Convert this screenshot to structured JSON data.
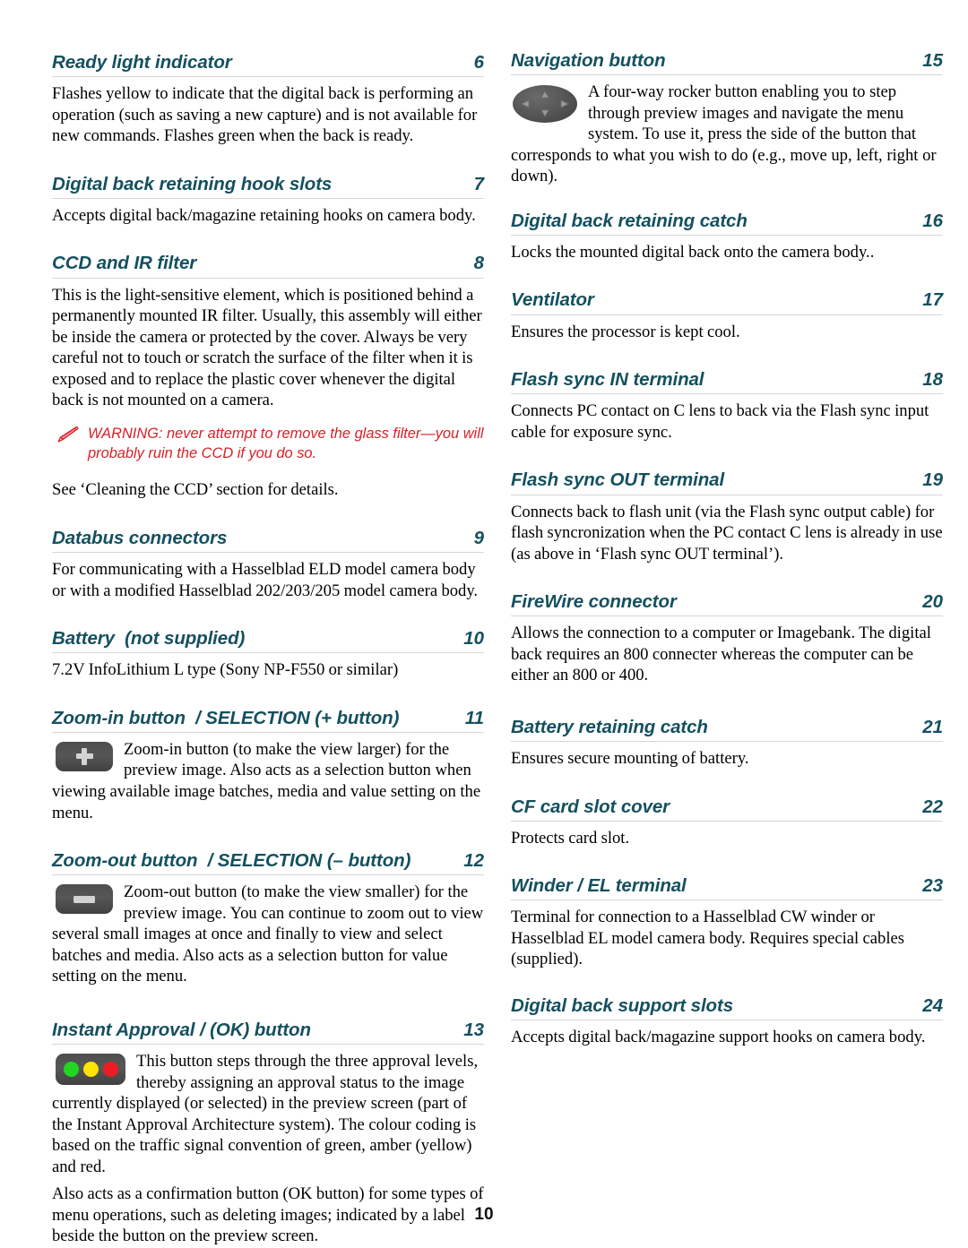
{
  "document": {
    "page_number": "10",
    "accent_color": "#14505f",
    "warning_color": "#d91f26",
    "rule_color": "#d6d6d6"
  },
  "left_column": {
    "sections": [
      {
        "title": "Ready light indicator",
        "number": "6",
        "paragraphs": [
          "Flashes yellow to indicate that the digital back is performing an operation (such as saving a new capture) and is not available for new commands. Flashes green when the back is ready."
        ]
      },
      {
        "title": "Digital back retaining hook slots",
        "number": "7",
        "paragraphs": [
          "Accepts digital back/magazine retaining hooks on camera body."
        ]
      },
      {
        "title": "CCD and IR filter",
        "number": "8",
        "paragraphs": [
          "This is the light-sensitive element, which is positioned behind a permanently mounted IR filter. Usually, this assembly will either be inside the camera or protected by the cover. Always be very careful not to touch or scratch the surface of the filter when it is exposed and to replace the plastic cover whenever the digital back is not mounted on a camera."
        ],
        "warning": "WARNING: never attempt to remove the glass filter—you will probably ruin the CCD if you do so.",
        "after_warning": "See ‘Cleaning the CCD’ section for details."
      },
      {
        "title": "Databus connectors",
        "number": "9",
        "paragraphs": [
          "For communicating with a Hasselblad ELD model camera body or with a modified Hasselblad 202/203/205 model camera body."
        ]
      },
      {
        "title": "Battery  (not supplied)",
        "number": "10",
        "paragraphs": [
          "7.2V InfoLithium L type (Sony NP-F550 or similar)"
        ]
      },
      {
        "title": "Zoom-in button  / SELECTION (+ button)",
        "number": "11",
        "icon": "zoom-in-plus-button-icon",
        "paragraphs": [
          "Zoom-in button (to make the view larger) for the preview image. Also acts as a selection button when viewing available image batches, media and value setting on the menu."
        ]
      },
      {
        "title": "Zoom-out button  / SELECTION (– button)",
        "number": "12",
        "icon": "zoom-out-minus-button-icon",
        "paragraphs": [
          "Zoom-out button (to make the view smaller) for the preview image. You can continue to zoom out to view several small images at once and finally to view and select batches and media. Also acts as a selection button for value setting on the menu."
        ]
      },
      {
        "title": "Instant Approval / (OK) button",
        "number": "13",
        "icon": "traffic-light-approval-button-icon",
        "paragraphs": [
          "This button steps through the three approval levels, thereby assigning an approval status to the image currently displayed (or selected) in the preview screen (part of the Instant Approval Architecture system). The colour coding is based on the traffic signal convention of green, amber (yellow) and red.",
          "Also acts as a confirmation button (OK button) for some types of menu operations, such as deleting images; indicated by a label beside the button on the preview screen."
        ]
      }
    ]
  },
  "right_column": {
    "sections": [
      {
        "title": "Navigation button",
        "number": "15",
        "icon": "four-way-rocker-button-icon",
        "paragraphs": [
          "A four-way rocker button enabling you to step through preview images and navigate the menu system. To use it, press the side of the button that corresponds to what you wish to do (e.g., move up, left, right or down)."
        ]
      },
      {
        "title": "Digital back retaining catch",
        "number": "16",
        "paragraphs": [
          "Locks the mounted digital back onto the camera body.."
        ]
      },
      {
        "title": "Ventilator",
        "number": "17",
        "paragraphs": [
          "Ensures the processor is kept cool."
        ]
      },
      {
        "title": "Flash sync IN terminal",
        "number": "18",
        "paragraphs": [
          "Connects PC contact on C lens to back via the Flash sync input cable for exposure sync."
        ]
      },
      {
        "title": "Flash sync OUT terminal",
        "number": "19",
        "paragraphs": [
          "Connects back to flash unit (via the Flash sync output cable) for flash syncronization when the PC contact C lens is already in use (as above in ‘Flash sync OUT terminal’)."
        ]
      },
      {
        "title": "FireWire connector",
        "number": "20",
        "paragraphs": [
          "Allows the connection to a computer or Imagebank. The digital back requires an 800 connecter whereas the computer can be either an 800 or 400."
        ]
      },
      {
        "title": "Battery retaining catch",
        "number": "21",
        "paragraphs": [
          "Ensures secure mounting of battery."
        ]
      },
      {
        "title": "CF card slot cover",
        "number": "22",
        "paragraphs": [
          "Protects card slot."
        ]
      },
      {
        "title": "Winder / EL terminal",
        "number": "23",
        "paragraphs": [
          "Terminal for connection to a Hasselblad CW winder or Hasselblad EL model camera body. Requires special cables (supplied)."
        ]
      },
      {
        "title": "Digital back support slots",
        "number": "24",
        "paragraphs": [
          "Accepts digital back/magazine support hooks on camera body."
        ]
      }
    ]
  },
  "icon_colors": {
    "button_body": "#4e4e4e",
    "glyph": "#d3d3d3",
    "approval_green": "#22d521",
    "approval_yellow": "#ffe400",
    "approval_red": "#ec1c24"
  }
}
